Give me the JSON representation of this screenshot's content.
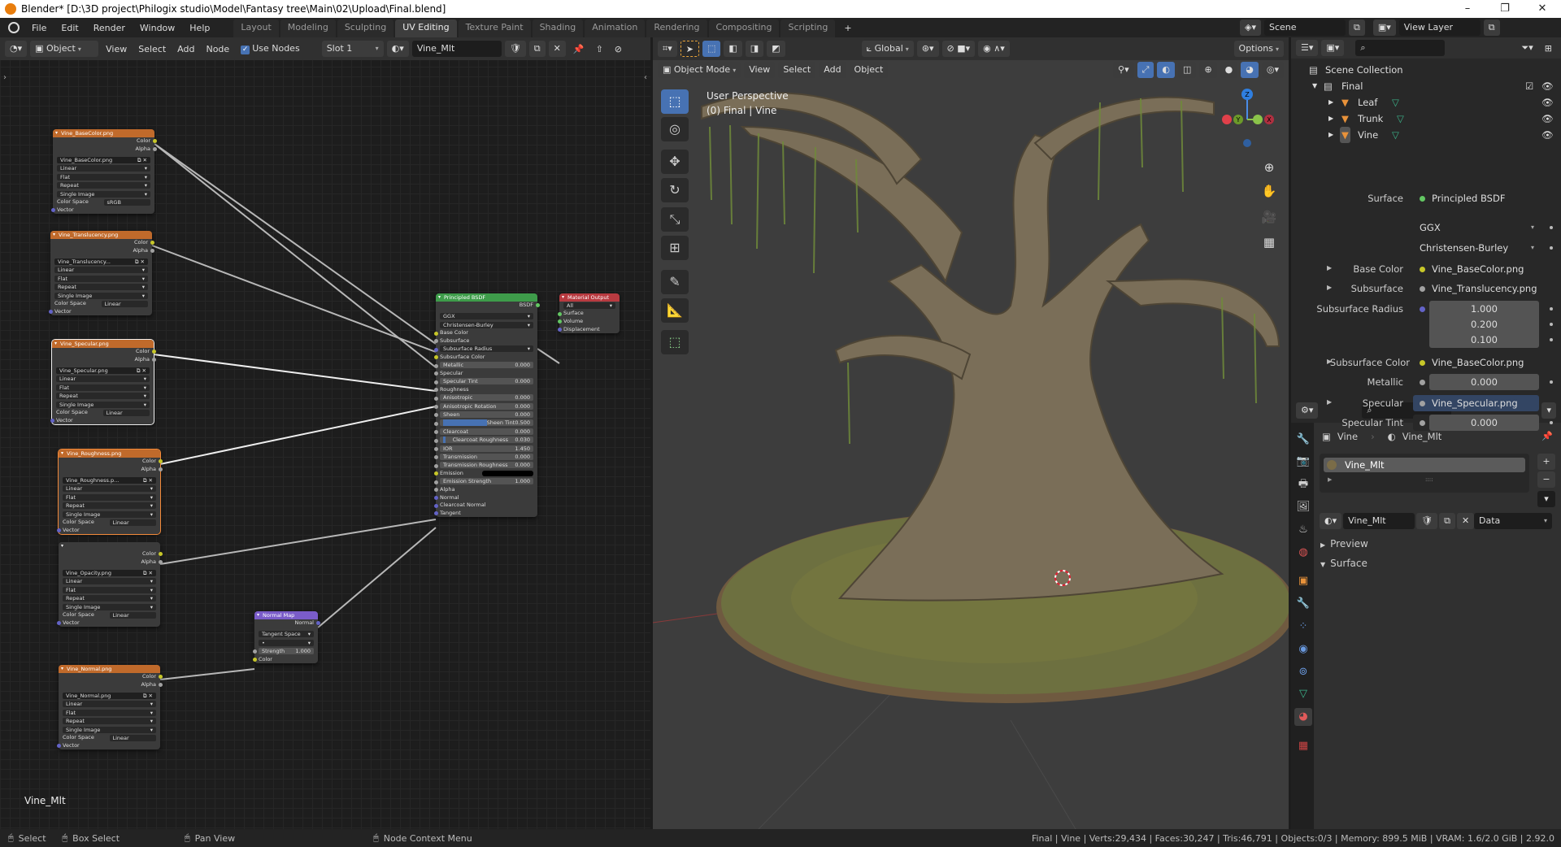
{
  "window": {
    "title": "Blender* [D:\\3D project\\Philogix studio\\Model\\Fantasy tree\\Main\\02\\Upload\\Final.blend]",
    "minimize": "–",
    "maximize": "❐",
    "close": "✕"
  },
  "menu": [
    "File",
    "Edit",
    "Render",
    "Window",
    "Help"
  ],
  "workspaces": [
    {
      "label": "Layout"
    },
    {
      "label": "Modeling"
    },
    {
      "label": "Sculpting"
    },
    {
      "label": "UV Editing",
      "active": true
    },
    {
      "label": "Texture Paint"
    },
    {
      "label": "Shading"
    },
    {
      "label": "Animation"
    },
    {
      "label": "Rendering"
    },
    {
      "label": "Compositing"
    },
    {
      "label": "Scripting"
    }
  ],
  "add_workspace": "+",
  "scene": {
    "label": "Scene",
    "view_layer": "View Layer"
  },
  "node_header": {
    "mode": "Object",
    "view": "View",
    "select": "Select",
    "add": "Add",
    "node": "Node",
    "use_nodes": "Use Nodes",
    "slot": "Slot 1",
    "material": "Vine_Mlt"
  },
  "node_editor_label": "Vine_Mlt",
  "nodes": [
    {
      "title": "Vine_BaseColor.png",
      "color": "#c06a2b",
      "rows": [
        [
          "out",
          "Color",
          "#c7c729"
        ],
        [
          "out",
          "Alpha",
          "#a1a1a1"
        ],
        [
          "gap"
        ],
        [
          "img",
          "Vine_BaseColor.png"
        ],
        [
          "dd",
          "Linear"
        ],
        [
          "dd",
          "Flat"
        ],
        [
          "dd",
          "Repeat"
        ],
        [
          "dd",
          "Single Image"
        ],
        [
          "cs",
          "Color Space",
          "sRGB"
        ],
        [
          "in",
          "Vector",
          "#6363c7"
        ]
      ]
    },
    {
      "title": "Vine_Translucency.png",
      "color": "#c06a2b",
      "rows": [
        [
          "out",
          "Color",
          "#c7c729"
        ],
        [
          "out",
          "Alpha",
          "#a1a1a1"
        ],
        [
          "gap"
        ],
        [
          "img",
          "Vine_Translucency..."
        ],
        [
          "dd",
          "Linear"
        ],
        [
          "dd",
          "Flat"
        ],
        [
          "dd",
          "Repeat"
        ],
        [
          "dd",
          "Single Image"
        ],
        [
          "cs",
          "Color Space",
          "Linear"
        ],
        [
          "in",
          "Vector",
          "#6363c7"
        ]
      ]
    },
    {
      "title": "Vine_Specular.png",
      "color": "#c06a2b",
      "rows": [
        [
          "out",
          "Color",
          "#c7c729"
        ],
        [
          "out",
          "Alpha",
          "#a1a1a1"
        ],
        [
          "gap"
        ],
        [
          "img",
          "Vine_Specular.png"
        ],
        [
          "dd",
          "Linear"
        ],
        [
          "dd",
          "Flat"
        ],
        [
          "dd",
          "Repeat"
        ],
        [
          "dd",
          "Single Image"
        ],
        [
          "cs",
          "Color Space",
          "Linear"
        ],
        [
          "in",
          "Vector",
          "#6363c7"
        ]
      ]
    },
    {
      "title": "Vine_Roughness.png",
      "color": "#c06a2b",
      "rows": [
        [
          "out",
          "Color",
          "#c7c729"
        ],
        [
          "out",
          "Alpha",
          "#a1a1a1"
        ],
        [
          "gap"
        ],
        [
          "img",
          "Vine_Roughness.p..."
        ],
        [
          "dd",
          "Linear"
        ],
        [
          "dd",
          "Flat"
        ],
        [
          "dd",
          "Repeat"
        ],
        [
          "dd",
          "Single Image"
        ],
        [
          "cs",
          "Color Space",
          "Linear"
        ],
        [
          "in",
          "Vector",
          "#6363c7"
        ]
      ]
    },
    {
      "title": "",
      "color": "#3b3b3b",
      "rows": [
        [
          "out",
          "Color",
          "#c7c729"
        ],
        [
          "out",
          "Alpha",
          "#a1a1a1"
        ],
        [
          "gap"
        ],
        [
          "img",
          "Vine_Opacity.png"
        ],
        [
          "dd",
          "Linear"
        ],
        [
          "dd",
          "Flat"
        ],
        [
          "dd",
          "Repeat"
        ],
        [
          "dd",
          "Single Image"
        ],
        [
          "cs",
          "Color Space",
          "Linear"
        ],
        [
          "in",
          "Vector",
          "#6363c7"
        ]
      ]
    },
    {
      "title": "Vine_Normal.png",
      "color": "#c06a2b",
      "rows": [
        [
          "out",
          "Color",
          "#c7c729"
        ],
        [
          "out",
          "Alpha",
          "#a1a1a1"
        ],
        [
          "gap"
        ],
        [
          "img",
          "Vine_Normal.png"
        ],
        [
          "dd",
          "Linear"
        ],
        [
          "dd",
          "Flat"
        ],
        [
          "dd",
          "Repeat"
        ],
        [
          "dd",
          "Single Image"
        ],
        [
          "cs",
          "Color Space",
          "Linear"
        ],
        [
          "in",
          "Vector",
          "#6363c7"
        ]
      ]
    },
    {
      "title": "Normal Map",
      "color": "#7a5cc9",
      "rows": [
        [
          "out",
          "Normal",
          "#6363c7"
        ],
        [
          "gap"
        ],
        [
          "dd",
          "Tangent Space"
        ],
        [
          "dd",
          "•"
        ],
        [
          "val",
          "Strength",
          "1.000",
          "#a1a1a1"
        ],
        [
          "in",
          "Color",
          "#c7c729"
        ]
      ]
    },
    {
      "title": "Principled BSDF",
      "color": "#3e9c4a",
      "rows": [
        [
          "out",
          "BSDF",
          "#63c763"
        ],
        [
          "gap"
        ],
        [
          "dd",
          "GGX"
        ],
        [
          "dd",
          "Christensen-Burley"
        ],
        [
          "in",
          "Base Color",
          "#c7c729"
        ],
        [
          "in",
          "Subsurface",
          "#a1a1a1"
        ],
        [
          "ddin",
          "Subsurface Radius",
          "#6363c7"
        ],
        [
          "in",
          "Subsurface Color",
          "#c7c729"
        ],
        [
          "val",
          "Metallic",
          "0.000",
          "#a1a1a1"
        ],
        [
          "in",
          "Specular",
          "#a1a1a1"
        ],
        [
          "val",
          "Specular Tint",
          "0.000",
          "#a1a1a1"
        ],
        [
          "in",
          "Roughness",
          "#a1a1a1"
        ],
        [
          "val",
          "Anisotropic",
          "0.000",
          "#a1a1a1"
        ],
        [
          "val",
          "Anisotropic Rotation",
          "0.000",
          "#a1a1a1"
        ],
        [
          "val",
          "Sheen",
          "0.000",
          "#a1a1a1"
        ],
        [
          "val",
          "Sheen Tint",
          "0.500",
          "#a1a1a1",
          0.5
        ],
        [
          "val",
          "Clearcoat",
          "0.000",
          "#a1a1a1"
        ],
        [
          "val",
          "Clearcoat Roughness",
          "0.030",
          "#a1a1a1",
          0.03
        ],
        [
          "val",
          "IOR",
          "1.450",
          "#a1a1a1"
        ],
        [
          "val",
          "Transmission",
          "0.000",
          "#a1a1a1"
        ],
        [
          "val",
          "Transmission Roughness",
          "0.000",
          "#a1a1a1"
        ],
        [
          "color",
          "Emission",
          "#c7c729"
        ],
        [
          "val",
          "Emission Strength",
          "1.000",
          "#a1a1a1"
        ],
        [
          "in",
          "Alpha",
          "#a1a1a1"
        ],
        [
          "in",
          "Normal",
          "#6363c7"
        ],
        [
          "in",
          "Clearcoat Normal",
          "#6363c7"
        ],
        [
          "in",
          "Tangent",
          "#6363c7"
        ]
      ]
    },
    {
      "title": "Material Output",
      "color": "#b83a40",
      "rows": [
        [
          "dd",
          "All"
        ],
        [
          "in",
          "Surface",
          "#63c763"
        ],
        [
          "in",
          "Volume",
          "#63c763"
        ],
        [
          "in",
          "Displacement",
          "#6363c7"
        ]
      ]
    }
  ],
  "viewport": {
    "transform": "Global",
    "options": "Options",
    "mode": "Object Mode",
    "view": "View",
    "select": "Select",
    "add": "Add",
    "object": "Object",
    "perspective": "User Perspective",
    "context": "(0) Final | Vine",
    "gizmo": {
      "z": "Z",
      "y": "Y",
      "x": "X"
    }
  },
  "outliner": {
    "root": "Scene Collection",
    "collection": "Final",
    "objects": [
      "Leaf",
      "Trunk",
      "Vine"
    ]
  },
  "properties": {
    "object": "Vine",
    "material": "Vine_Mlt",
    "slot": "Vine_Mlt",
    "link": "Data",
    "preview": "Preview",
    "surface_panel": "Surface",
    "rows": [
      {
        "label": "Surface",
        "value": "Principled BSDF",
        "dot": "#63c763"
      },
      {
        "label": "",
        "value": "GGX",
        "dropdown": true
      },
      {
        "label": "",
        "value": "Christensen-Burley",
        "dropdown": true
      },
      {
        "label": "Base Color",
        "value": "Vine_BaseColor.png",
        "dot": "#c7c729",
        "expand": true
      },
      {
        "label": "Subsurface",
        "value": "Vine_Translucency.png",
        "dot": "#a1a1a1",
        "expand": true
      },
      {
        "label": "Subsurface Radius",
        "values": [
          "1.000",
          "0.200",
          "0.100"
        ],
        "dot": "#6363c7"
      },
      {
        "label": "Subsurface Color",
        "value": "Vine_BaseColor.png",
        "dot": "#c7c729",
        "expand": true
      },
      {
        "label": "Metallic",
        "value": "0.000",
        "dot": "#a1a1a1",
        "numeric": true
      },
      {
        "label": "Specular",
        "value": "Vine_Specular.png",
        "dot": "#a1a1a1",
        "expand": true,
        "highlight": true
      },
      {
        "label": "Specular Tint",
        "value": "0.000",
        "dot": "#a1a1a1",
        "numeric": true
      }
    ]
  },
  "status": {
    "select": "Select",
    "box_select": "Box Select",
    "pan_view": "Pan View",
    "context_menu": "Node Context Menu",
    "stats": "Final | Vine | Verts:29,434 | Faces:30,247 | Tris:46,791 | Objects:0/3 | Memory: 899.5 MiB | VRAM: 1.6/2.0 GiB | 2.92.0"
  }
}
